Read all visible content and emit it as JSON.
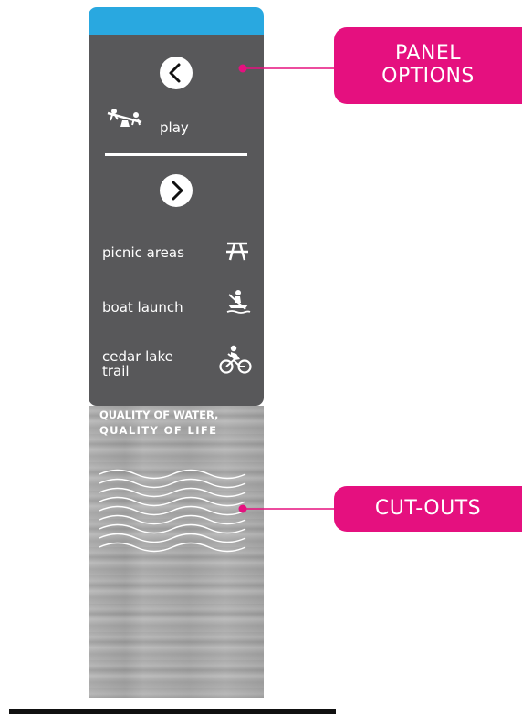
{
  "panel": {
    "prev_label": "play",
    "items": [
      {
        "label": "picnic areas",
        "icon": "picnic-table-icon"
      },
      {
        "label": "boat launch",
        "icon": "boat-launch-icon"
      },
      {
        "label_line1": "cedar lake",
        "label_line2": "trail",
        "icon": "cyclist-icon"
      }
    ]
  },
  "slogan": {
    "line1": "QUALITY OF WATER,",
    "line2": "QUALITY OF LIFE"
  },
  "callouts": {
    "panel_options_line1": "PANEL",
    "panel_options_line2": "OPTIONS",
    "cut_outs": "CUT-OUTS"
  },
  "colors": {
    "accent": "#e5107f",
    "top_band": "#29a8e0",
    "panel": "#58585a"
  }
}
